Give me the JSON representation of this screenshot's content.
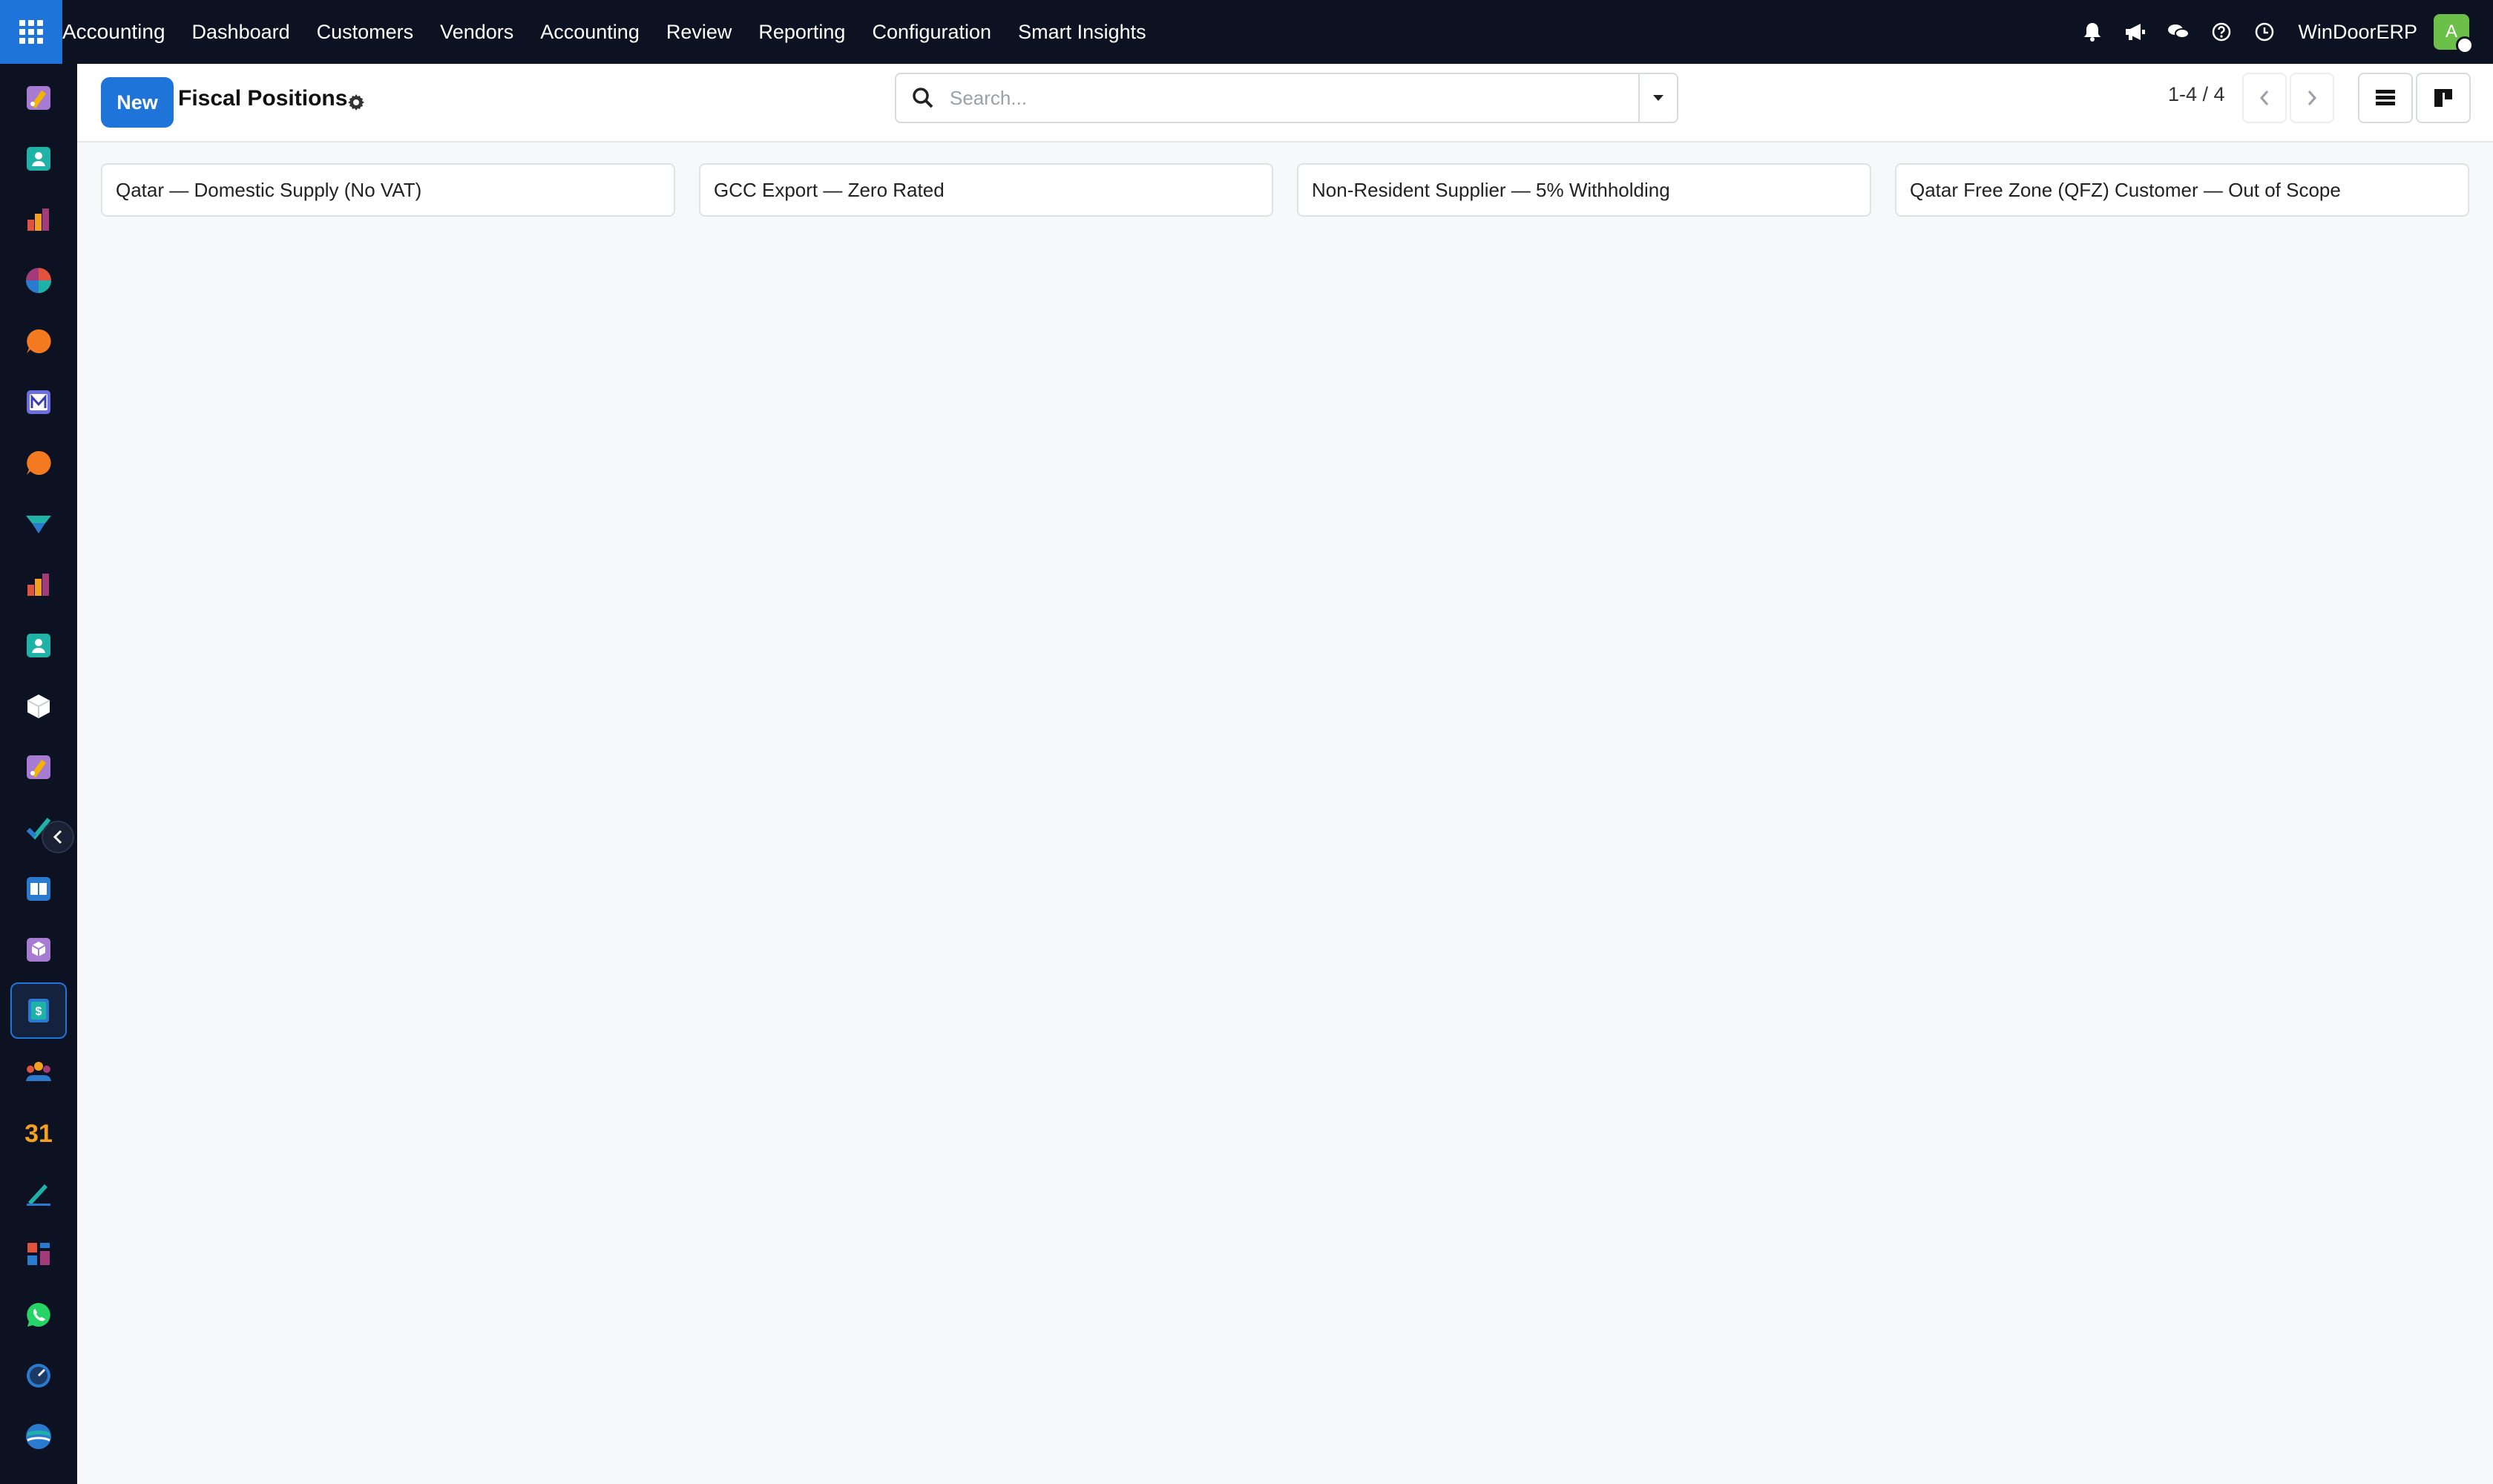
{
  "topbar": {
    "brand": "Accounting",
    "menu": [
      "Dashboard",
      "Customers",
      "Vendors",
      "Accounting",
      "Review",
      "Reporting",
      "Configuration",
      "Smart Insights"
    ],
    "company": "WinDoorERP",
    "avatar_letter": "A",
    "icons": [
      "bell-icon",
      "megaphone-icon",
      "chat-icon",
      "help-icon",
      "clock-icon"
    ]
  },
  "control": {
    "new_label": "New",
    "title": "Fiscal Positions",
    "search_placeholder": "Search...",
    "pager": "1-4 / 4"
  },
  "records": [
    "Qatar — Domestic Supply (No VAT)",
    "GCC Export — Zero Rated",
    "Non-Resident Supplier — 5% Withholding",
    "Qatar Free Zone (QFZ) Customer — Out of Scope"
  ],
  "sidebar_apps": [
    "app-studio",
    "contacts",
    "reporting",
    "discuss-hub",
    "live-chat",
    "email-marketing",
    "chat",
    "delivery",
    "dashboards",
    "employees",
    "inventory",
    "studio",
    "project",
    "knowledge",
    "manufacturing",
    "accounting",
    "team",
    "calendar",
    "sign",
    "dashboard-builder",
    "whatsapp",
    "timer",
    "website"
  ],
  "colors": {
    "topbar": "#0d1222",
    "accent": "#1e74d8",
    "avatar": "#6cc04a"
  }
}
